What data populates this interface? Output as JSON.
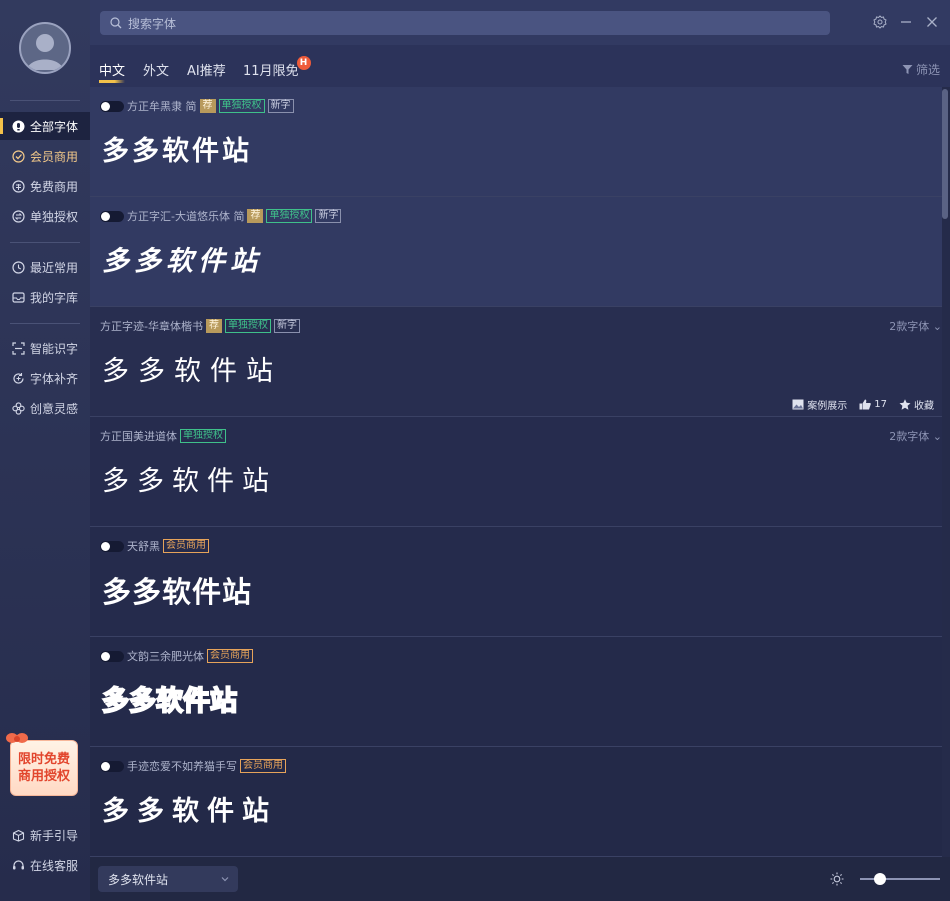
{
  "search": {
    "placeholder": "搜索字体"
  },
  "sidebar": {
    "items": [
      {
        "label": "全部字体"
      },
      {
        "label": "会员商用"
      },
      {
        "label": "免费商用"
      },
      {
        "label": "单独授权"
      },
      {
        "label": "最近常用"
      },
      {
        "label": "我的字库"
      },
      {
        "label": "智能识字"
      },
      {
        "label": "字体补齐"
      },
      {
        "label": "创意灵感"
      }
    ],
    "promo": {
      "line1": "限时免费",
      "line2": "商用授权"
    },
    "bottom_items": [
      {
        "label": "新手引导"
      },
      {
        "label": "在线客服"
      }
    ]
  },
  "tabs": [
    {
      "label": "中文"
    },
    {
      "label": "外文"
    },
    {
      "label": "AI推荐"
    },
    {
      "label": "11月限免"
    }
  ],
  "hot_badge": "H",
  "filter_label": "筛选",
  "fonts": [
    {
      "name": "方正牟黑隶 简",
      "tags": [
        "荐",
        "单独授权",
        "新字"
      ],
      "preview": "多多软件站"
    },
    {
      "name": "方正字汇-大道悠乐体 简",
      "tags": [
        "荐",
        "单独授权",
        "新字"
      ],
      "preview": "多多软件站"
    },
    {
      "name": "方正字迹-华章体楷书",
      "tags": [
        "荐",
        "单独授权",
        "新字"
      ],
      "preview": "多多软件站",
      "count": "2款字体",
      "actions": {
        "showcase": "案例展示",
        "likes": "17",
        "collect": "收藏"
      }
    },
    {
      "name": "方正国美进道体",
      "tags": [
        "单独授权"
      ],
      "preview": "多多软件站",
      "count": "2款字体"
    },
    {
      "name": "天舒黑",
      "tags": [
        "会员商用"
      ],
      "preview": "多多软件站"
    },
    {
      "name": "文韵三余肥光体",
      "tags": [
        "会员商用"
      ],
      "preview": "多多软件站"
    },
    {
      "name": "手迹恋爱不如养猫手写",
      "tags": [
        "会员商用"
      ],
      "preview": "多多软件站"
    }
  ],
  "bottom": {
    "sample_text": "多多软件站",
    "preview_size_fraction": 0.25
  },
  "colors": {
    "accent": "#f3c14a",
    "auth_tag": "#3fc08a",
    "member_tag": "#e6a35a",
    "background": "#252b4a"
  }
}
